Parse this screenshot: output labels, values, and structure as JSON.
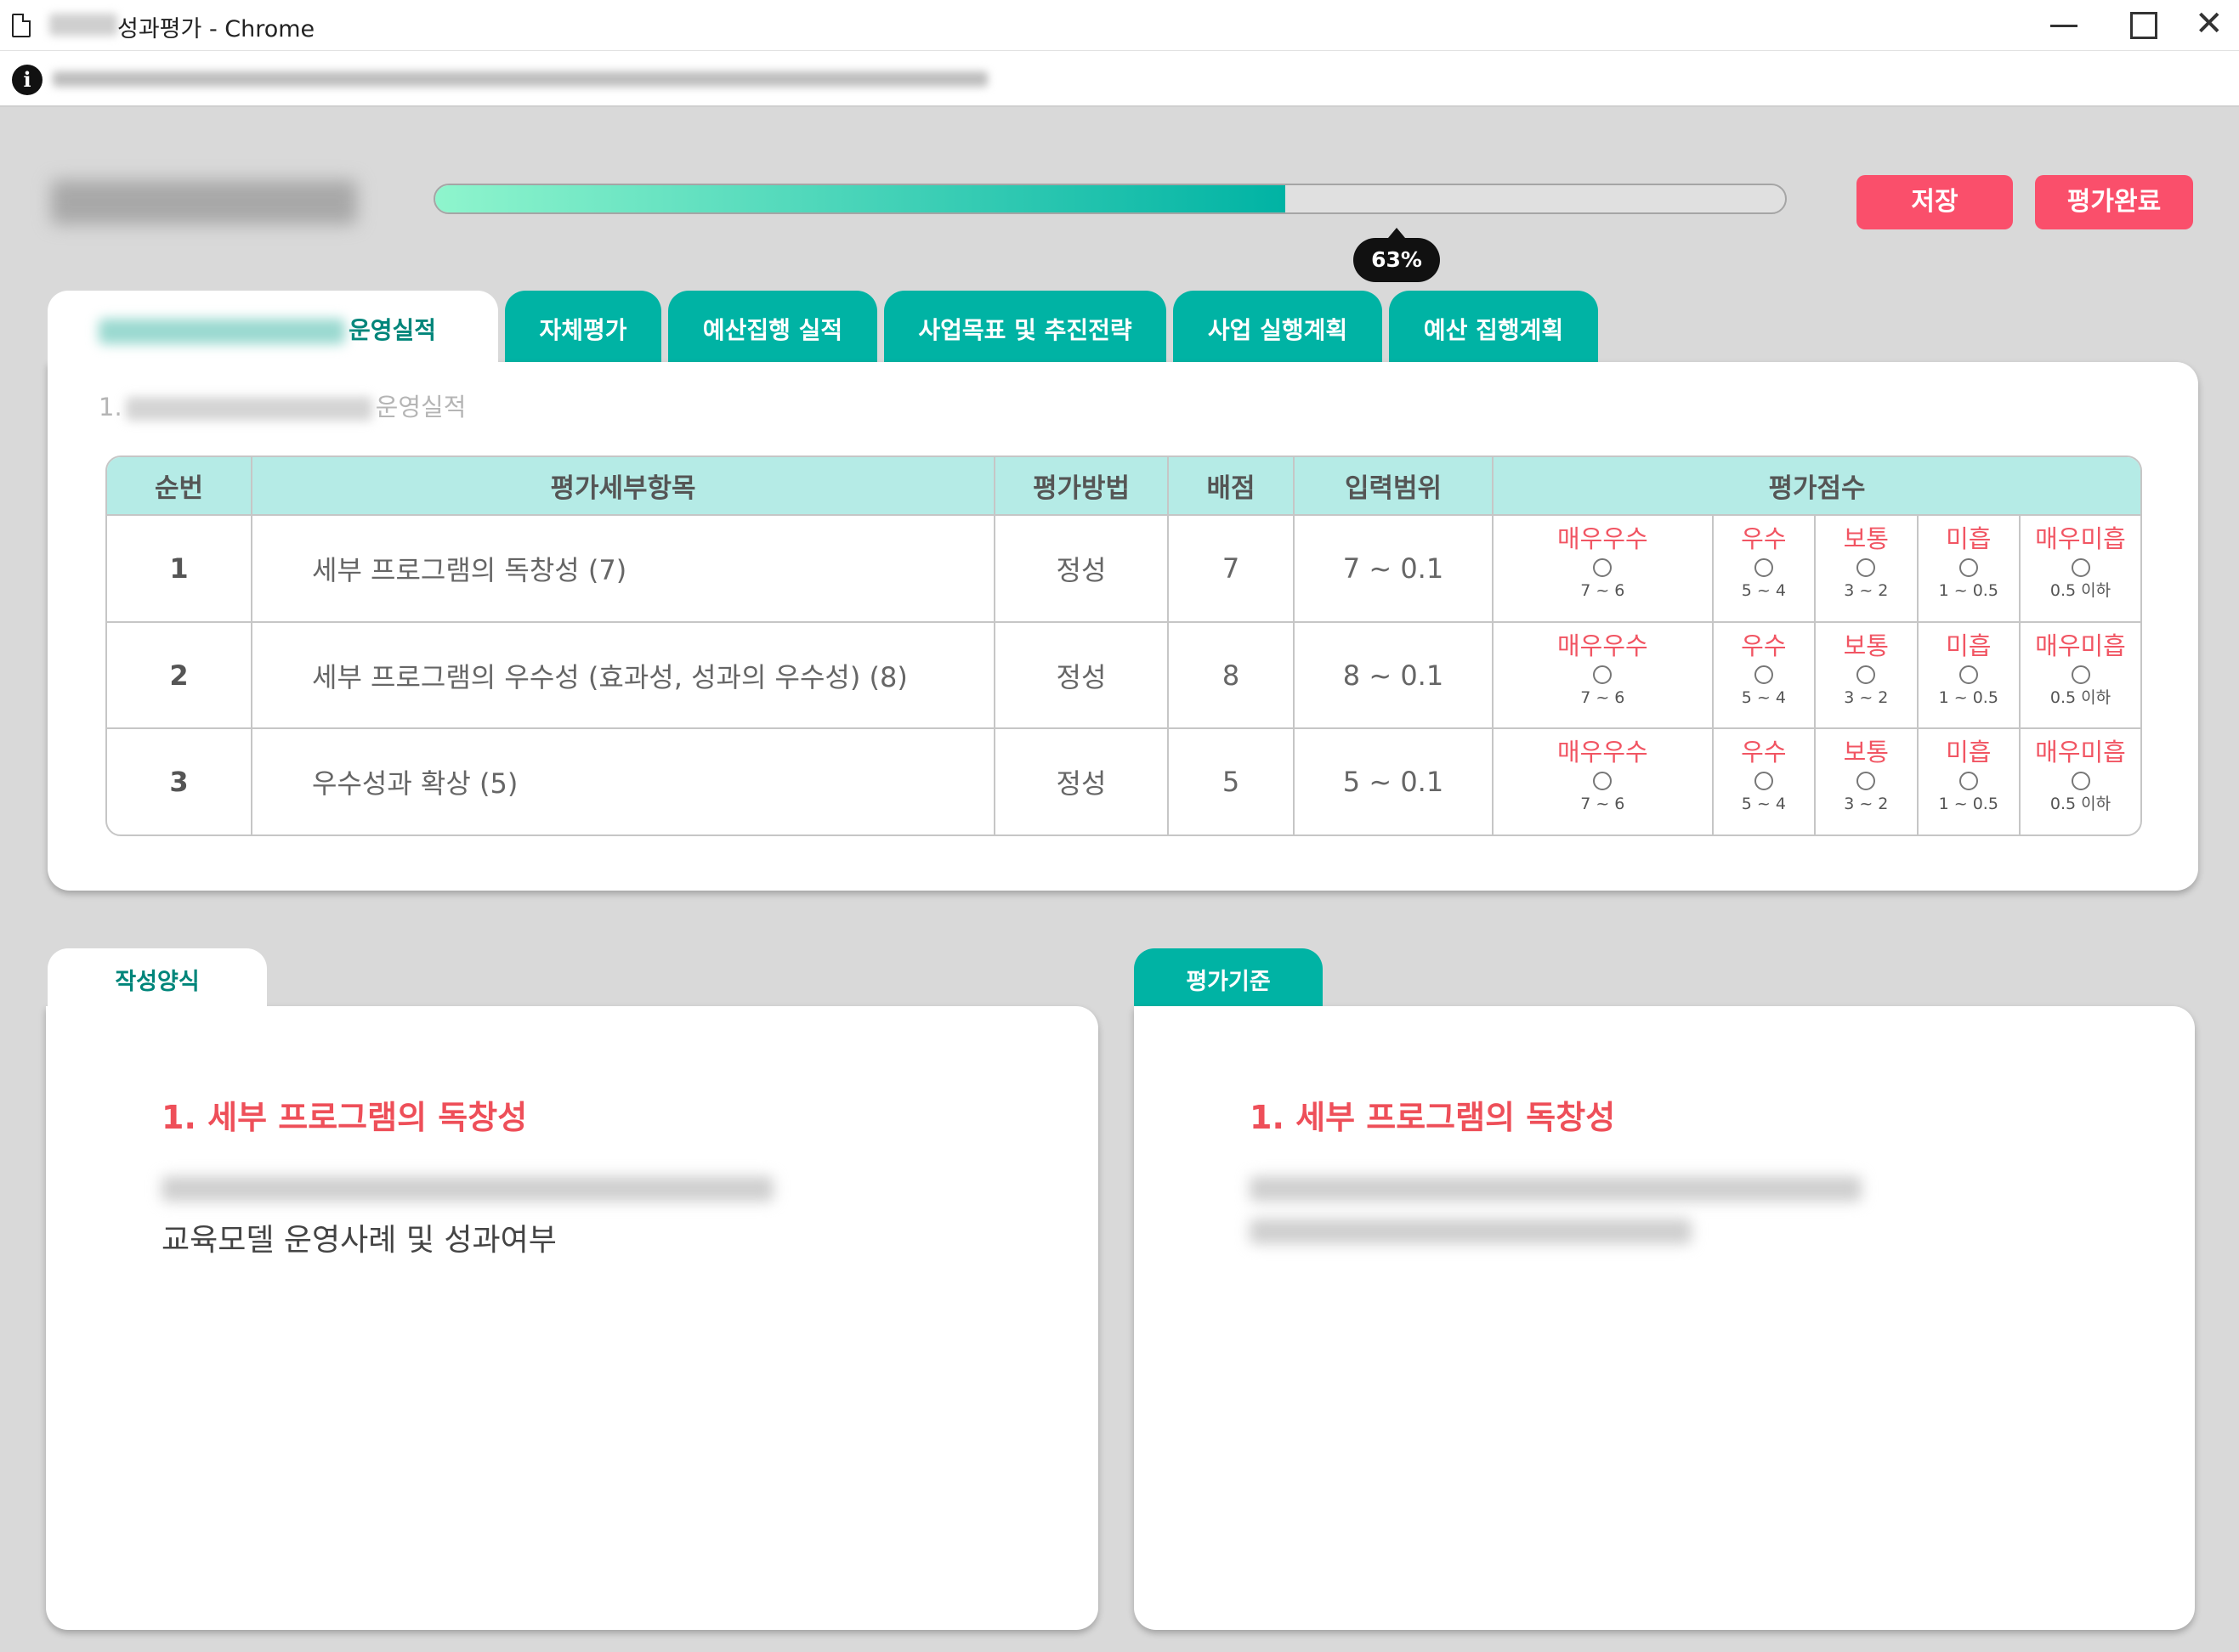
{
  "window": {
    "title": "성과평가 - Chrome"
  },
  "progress": {
    "percent_label": "63%",
    "value": 0.63
  },
  "header": {
    "save_label": "저장",
    "complete_label": "평가완료"
  },
  "tabs": [
    {
      "label": "운영실적"
    },
    {
      "label": "자체평가"
    },
    {
      "label": "예산집행 실적"
    },
    {
      "label": "사업목표 및 추진전략"
    },
    {
      "label": "사업 실행계획"
    },
    {
      "label": "예산 집행계획"
    }
  ],
  "section": {
    "prefix": "1.",
    "title": "운영실적"
  },
  "table": {
    "headers": {
      "seq": "순번",
      "item": "평가세부항목",
      "method": "평가방법",
      "points": "배점",
      "range": "입력범위",
      "score": "평가점수"
    },
    "rows": [
      {
        "seq": "1",
        "item": "세부 프로그램의 독창성 (7)",
        "method": "정성",
        "points": "7",
        "range": "7 ~ 0.1",
        "ranges": [
          "7 ~ 6",
          "5 ~ 4",
          "3 ~ 2",
          "1 ~ 0.5",
          "0.5 이하"
        ]
      },
      {
        "seq": "2",
        "item": "세부 프로그램의 우수성 (효과성, 성과의 우수성) (8)",
        "method": "정성",
        "points": "8",
        "range": "8 ~ 0.1",
        "ranges": [
          "7 ~ 6",
          "5 ~ 4",
          "3 ~ 2",
          "1 ~ 0.5",
          "0.5 이하"
        ]
      },
      {
        "seq": "3",
        "item": "우수성과 확상 (5)",
        "method": "정성",
        "points": "5",
        "range": "5 ~ 0.1",
        "ranges": [
          "7 ~ 6",
          "5 ~ 4",
          "3 ~ 2",
          "1 ~ 0.5",
          "0.5 이하"
        ]
      }
    ],
    "grades": [
      "매우우수",
      "우수",
      "보통",
      "미흡",
      "매우미흡"
    ]
  },
  "left_panel": {
    "tab_label": "작성양식",
    "heading": "1. 세부 프로그램의 독창성",
    "text": "교육모델 운영사례 및 성과여부"
  },
  "right_panel": {
    "tab_label": "평가기준",
    "heading": "1. 세부 프로그램의 독창성"
  },
  "colors": {
    "accent": "#00b3a4",
    "pink": "#fa4f6b",
    "grade_red": "#f15563",
    "header_bg": "#b5ebe6"
  }
}
